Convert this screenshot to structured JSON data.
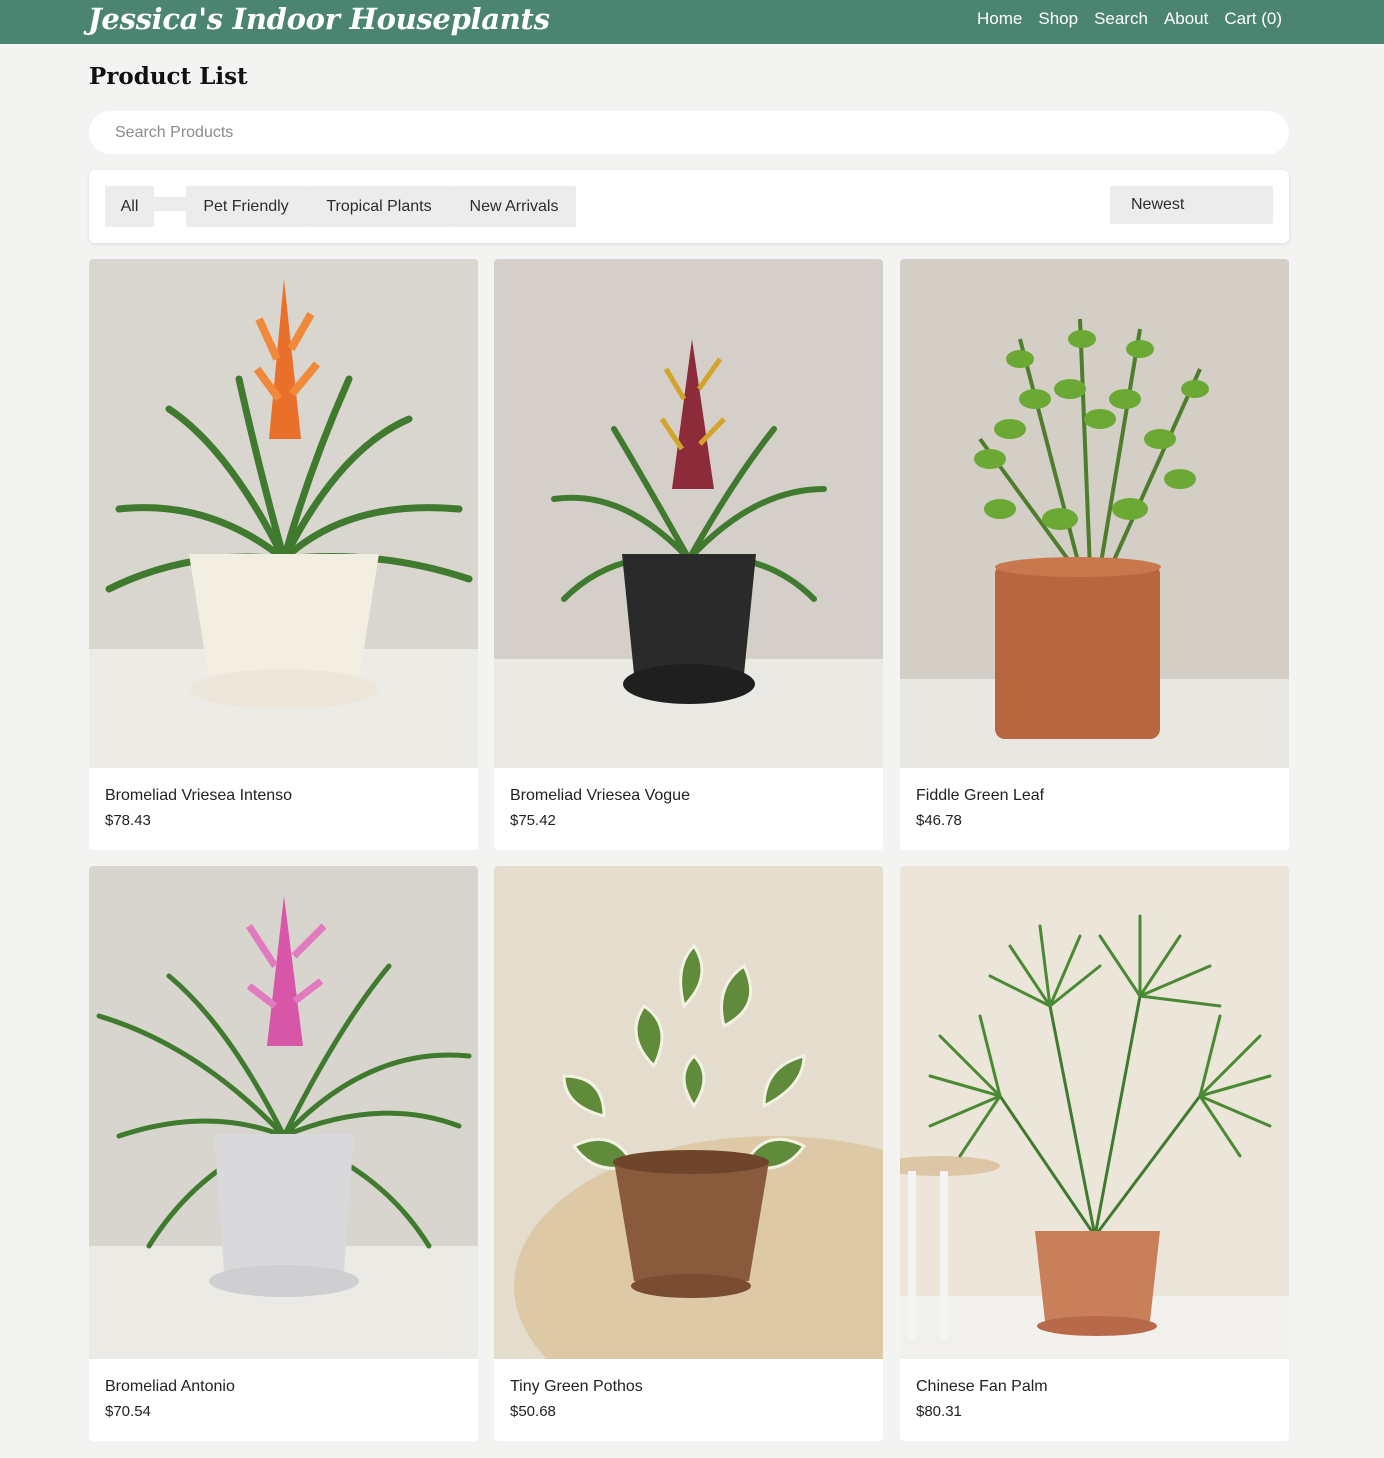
{
  "header": {
    "brand": "Jessica's Indoor Houseplants",
    "nav": [
      "Home",
      "Shop",
      "Search",
      "About",
      "Cart (0)"
    ]
  },
  "page": {
    "title": "Product List"
  },
  "search": {
    "placeholder": "Search Products",
    "value": ""
  },
  "filters": {
    "chips": [
      "All",
      "Pet Friendly",
      "Tropical Plants",
      "New Arrivals"
    ],
    "sort": "Newest"
  },
  "products": [
    {
      "name": "Bromeliad Vriesea Intenso",
      "price": "$78.43",
      "flower": "orange-bromeliad-icon",
      "pot": "cream-pot-icon"
    },
    {
      "name": "Bromeliad Vriesea Vogue",
      "price": "$75.42",
      "flower": "red-bromeliad-icon",
      "pot": "black-pot-icon"
    },
    {
      "name": "Fiddle Green Leaf",
      "price": "$46.78",
      "flower": "zz-leaves-icon",
      "pot": "terracotta-pot-icon"
    },
    {
      "name": "Bromeliad Antonio",
      "price": "$70.54",
      "flower": "pink-bromeliad-icon",
      "pot": "grey-pot-icon"
    },
    {
      "name": "Tiny Green Pothos",
      "price": "$50.68",
      "flower": "pothos-leaves-icon",
      "pot": "clay-pot-icon"
    },
    {
      "name": "Chinese Fan Palm",
      "price": "$80.31",
      "flower": "fan-palm-icon",
      "pot": "clay-pot-icon"
    }
  ],
  "colors": {
    "header_bg": "#4b8470",
    "page_bg": "#f3f3f2",
    "chip_bg": "#ececec"
  }
}
